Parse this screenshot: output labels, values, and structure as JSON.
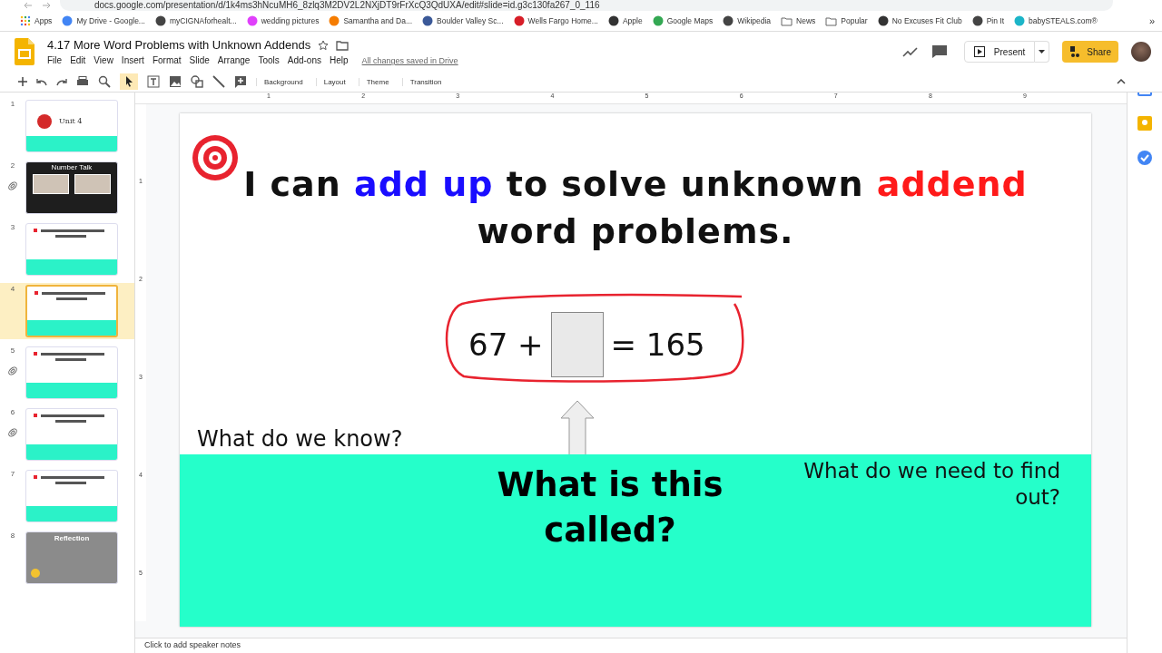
{
  "browser": {
    "url": "docs.google.com/presentation/d/1k4ms3hNcuMH6_8zlq3M2DV2L2NXjDT9rFrXcQ3QdUXA/edit#slide=id.g3c130fa267_0_116",
    "bookmarks": [
      {
        "label": "Apps",
        "kind": "apps"
      },
      {
        "label": "My Drive - Google...",
        "kind": "g"
      },
      {
        "label": "myCIGNAforhealt...",
        "kind": "globe"
      },
      {
        "label": "wedding pictures",
        "kind": "photos"
      },
      {
        "label": "Samantha and Da...",
        "kind": "orange"
      },
      {
        "label": "Boulder Valley Sc...",
        "kind": "school"
      },
      {
        "label": "Wells Fargo Home...",
        "kind": "wf"
      },
      {
        "label": "Apple",
        "kind": "apple"
      },
      {
        "label": "Google Maps",
        "kind": "maps"
      },
      {
        "label": "Wikipedia",
        "kind": "globe"
      },
      {
        "label": "News",
        "kind": "folder"
      },
      {
        "label": "Popular",
        "kind": "folder"
      },
      {
        "label": "No Excuses Fit Club",
        "kind": "fit"
      },
      {
        "label": "Pin It",
        "kind": "globe"
      },
      {
        "label": "babySTEALS.com®",
        "kind": "s"
      }
    ],
    "more": "»"
  },
  "doc": {
    "title": "4.17 More Word Problems with Unknown Addends",
    "menus": [
      "File",
      "Edit",
      "View",
      "Insert",
      "Format",
      "Slide",
      "Arrange",
      "Tools",
      "Add-ons",
      "Help"
    ],
    "save_status": "All changes saved in Drive",
    "present": "Present",
    "share": "Share"
  },
  "toolbar": {
    "buttons": [
      "Background",
      "Layout",
      "Theme",
      "Transition"
    ]
  },
  "ruler": [
    "1",
    "2",
    "3",
    "4",
    "5",
    "6",
    "7",
    "8",
    "9"
  ],
  "vruler": [
    "1",
    "2",
    "3",
    "4",
    "5"
  ],
  "filmstrip": [
    {
      "number": "1",
      "kind": "title",
      "linked": false,
      "selected": false,
      "title": "Unit 4"
    },
    {
      "number": "2",
      "kind": "dark",
      "linked": true,
      "selected": false,
      "title": "Number Talk"
    },
    {
      "number": "3",
      "kind": "lesson",
      "linked": false,
      "selected": false
    },
    {
      "number": "4",
      "kind": "lesson",
      "linked": false,
      "selected": true
    },
    {
      "number": "5",
      "kind": "lesson",
      "linked": true,
      "selected": false
    },
    {
      "number": "6",
      "kind": "lesson",
      "linked": true,
      "selected": false
    },
    {
      "number": "7",
      "kind": "lesson",
      "linked": false,
      "selected": false
    },
    {
      "number": "8",
      "kind": "reflection",
      "linked": false,
      "selected": false,
      "title": "Reflection"
    }
  ],
  "slide": {
    "heading": [
      [
        {
          "text": "I can ",
          "color": "#111111"
        },
        {
          "text": "add up",
          "color": "#1a0dff"
        },
        {
          "text": " to solve unknown ",
          "color": "#111111"
        },
        {
          "text": "addend",
          "color": "#ff1a1a"
        }
      ],
      [
        {
          "text": "word problems.",
          "color": "#111111"
        }
      ]
    ],
    "equation": {
      "left": "67 +",
      "right": "= 165"
    },
    "known": "What do we know?",
    "called": "What is this called?",
    "find_out": "What do we need to find out?"
  },
  "notes_placeholder": "Click to add speaker notes"
}
